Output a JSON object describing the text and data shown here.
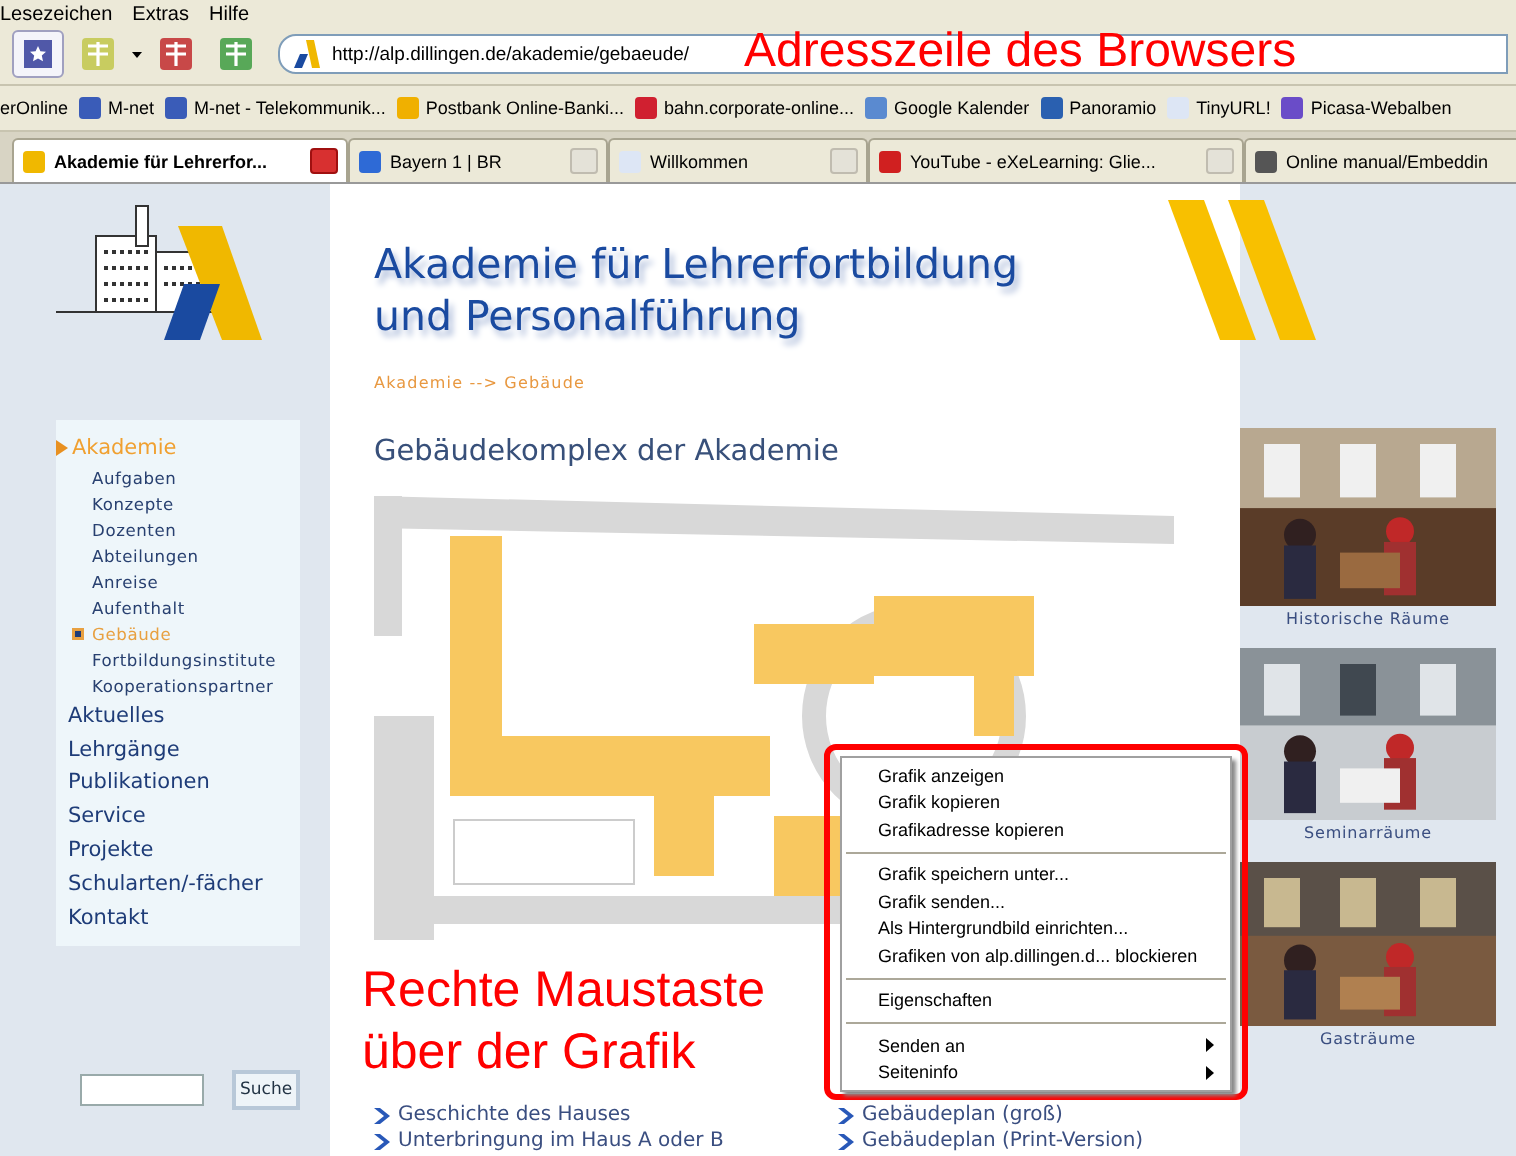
{
  "menu_bar": [
    {
      "label": "Lesezeichen"
    },
    {
      "label": "Extras"
    },
    {
      "label": "Hilfe"
    }
  ],
  "address_bar": {
    "url": "http://alp.dillingen.de/akademie/gebaeude/"
  },
  "annotation_top": {
    "text": "Adresszeile des Browsers"
  },
  "bookmarks": [
    {
      "label": "erOnline"
    },
    {
      "label": "M-net"
    },
    {
      "label": "M-net - Telekommunik..."
    },
    {
      "label": "Postbank Online-Banki..."
    },
    {
      "label": "bahn.corporate-online..."
    },
    {
      "label": "Google Kalender"
    },
    {
      "label": "Panoramio"
    },
    {
      "label": "TinyURL!"
    },
    {
      "label": "Picasa-Webalben"
    }
  ],
  "tabs": [
    {
      "label": "Akademie für Lehrerfor...",
      "selected": true
    },
    {
      "label": "Bayern 1 | BR",
      "selected": false
    },
    {
      "label": "Willkommen",
      "selected": false
    },
    {
      "label": "YouTube - eXeLearning: Glie...",
      "selected": false
    },
    {
      "label": "Online manual/Embeddin",
      "selected": false
    }
  ],
  "sidebar": {
    "nav": [
      {
        "label": "Akademie",
        "selected": true,
        "children": [
          {
            "label": "Aufgaben",
            "selected": false
          },
          {
            "label": "Konzepte",
            "selected": false
          },
          {
            "label": "Dozenten",
            "selected": false
          },
          {
            "label": "Abteilungen",
            "selected": false
          },
          {
            "label": "Anreise",
            "selected": false
          },
          {
            "label": "Aufenthalt",
            "selected": false
          },
          {
            "label": "Gebäude",
            "selected": true
          },
          {
            "label": "Fortbildungsinstitute",
            "selected": false
          },
          {
            "label": "Kooperationspartner",
            "selected": false
          }
        ]
      },
      {
        "label": "Aktuelles",
        "selected": false
      },
      {
        "label": "Lehrgänge",
        "selected": false
      },
      {
        "label": "Publikationen",
        "selected": false
      },
      {
        "label": "Service",
        "selected": false
      },
      {
        "label": "Projekte",
        "selected": false
      },
      {
        "label": "Schularten/-fächer",
        "selected": false
      },
      {
        "label": "Kontakt",
        "selected": false
      }
    ],
    "search_button": "Suche"
  },
  "content": {
    "title_lines": [
      "Akademie für Lehrerfortbildung",
      "und Personalführung"
    ],
    "breadcrumb": "Akademie -->  Gebäude",
    "heading": "Gebäudekomplex der Akademie",
    "annotation_lines": [
      "Rechte Maustaste",
      "über der Grafik"
    ],
    "links": [
      {
        "label": "Geschichte des Hauses"
      },
      {
        "label": "Gebäudeplan (groß)"
      },
      {
        "label": "Unterbringung im Haus A oder B"
      },
      {
        "label": "Gebäudeplan (Print-Version)"
      }
    ]
  },
  "photos": [
    {
      "caption": "Historische Räume"
    },
    {
      "caption": "Seminarräume"
    },
    {
      "caption": "Gasträume"
    }
  ],
  "context_menu": {
    "items": [
      {
        "kind": "item",
        "label": "Grafik anzeigen"
      },
      {
        "kind": "item",
        "label": "Grafik kopieren"
      },
      {
        "kind": "item",
        "label": "Grafikadresse kopieren"
      },
      {
        "kind": "separator"
      },
      {
        "kind": "item",
        "label": "Grafik speichern unter..."
      },
      {
        "kind": "item",
        "label": "Grafik senden..."
      },
      {
        "kind": "item",
        "label": "Als Hintergrundbild einrichten..."
      },
      {
        "kind": "item",
        "label": "Grafiken von alp.dillingen.d... blockieren"
      },
      {
        "kind": "separator"
      },
      {
        "kind": "item",
        "label": "Eigenschaften"
      },
      {
        "kind": "separator"
      },
      {
        "kind": "submenu",
        "label": "Senden an"
      },
      {
        "kind": "submenu",
        "label": "Seiteninfo"
      }
    ]
  }
}
